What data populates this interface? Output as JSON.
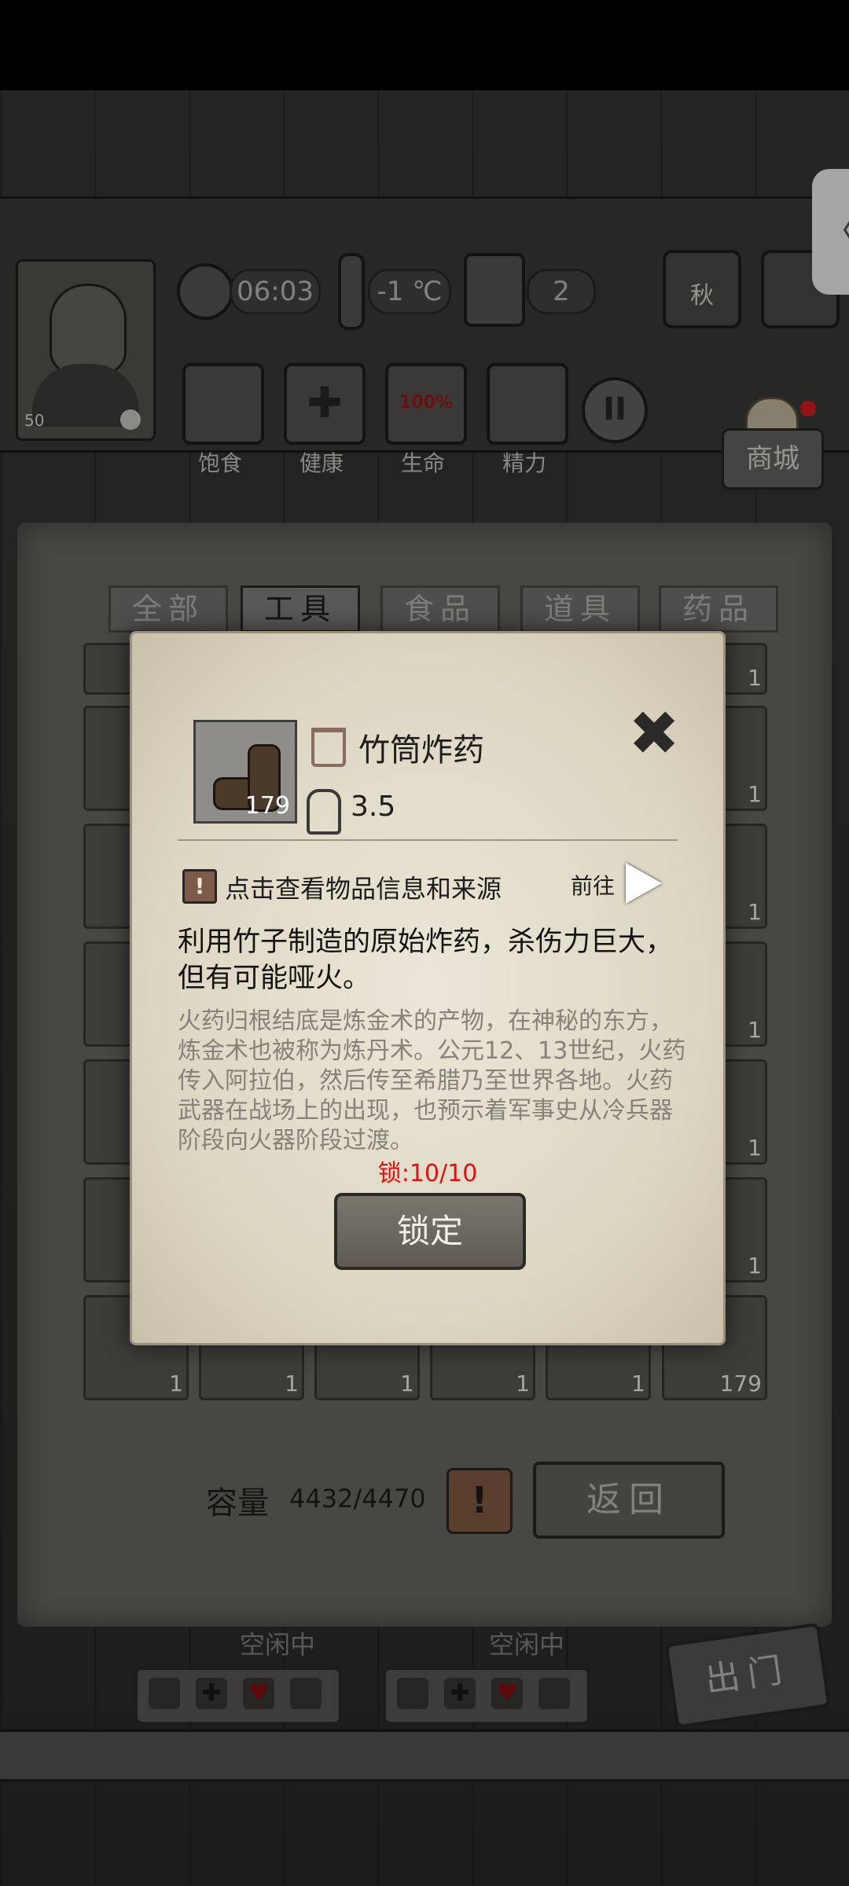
{
  "hud": {
    "time": "06:03",
    "temperature": "-1 ℃",
    "day": "2",
    "season": "秋",
    "level": "50",
    "stats": [
      {
        "label": "饱食",
        "icon": "stomach-icon",
        "glyph": ""
      },
      {
        "label": "健康",
        "icon": "health-cross-icon",
        "glyph": "✚"
      },
      {
        "label": "生命",
        "icon": "heart-icon",
        "glyph": "100%"
      },
      {
        "label": "精力",
        "icon": "energy-person-icon",
        "glyph": ""
      }
    ],
    "shop_label": "商城"
  },
  "inventory": {
    "tabs": [
      {
        "label": "全部",
        "active": false
      },
      {
        "label": "工具",
        "active": true
      },
      {
        "label": "食品",
        "active": false
      },
      {
        "label": "道具",
        "active": false
      },
      {
        "label": "药品",
        "active": false
      }
    ],
    "bottom_row_counts": [
      "1",
      "1",
      "1",
      "1",
      "1",
      "179"
    ],
    "right_column_counts": [
      "1",
      "1",
      "1",
      "1",
      "1",
      "1"
    ],
    "capacity_label": "容量",
    "capacity_value": "4432/4470",
    "alert_glyph": "!",
    "back_label": "返回"
  },
  "crew": [
    {
      "status": "空闲中"
    },
    {
      "status": "空闲中"
    }
  ],
  "go_out_label": "出门",
  "dialog": {
    "item_name": "竹筒炸药",
    "item_count": "179",
    "weight": "3.5",
    "info_link": "点击查看物品信息和来源",
    "goto_label": "前往",
    "description": "利用竹子制造的原始炸药，杀伤力巨大，但有可能哑火。",
    "lore": "火药归根结底是炼金术的产物，在神秘的东方，炼金术也被称为炼丹术。公元12、13世纪，火药传入阿拉伯，然后传至希腊乃至世界各地。火药武器在战场上的出现，也预示着军事史从冷兵器阶段向火器阶段过渡。",
    "lock_status": "锁:10/10",
    "lock_button": "锁定",
    "close_glyph": "✖"
  },
  "colors": {
    "lock_status": "#e01010",
    "parchment": "#e6e0d0",
    "wood_dark": "#2a2826"
  }
}
